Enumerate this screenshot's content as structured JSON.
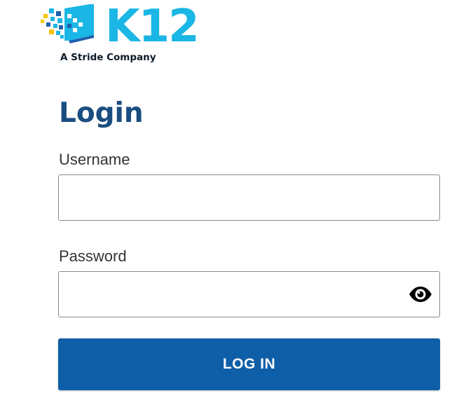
{
  "logo": {
    "wordmark": "K12",
    "tagline": "A Stride Company",
    "colors": {
      "cyan": "#1ab6e6",
      "blue": "#1e5fae",
      "yellow": "#f7c500",
      "navy": "#0d1b2a"
    }
  },
  "page": {
    "title": "Login"
  },
  "form": {
    "username_label": "Username",
    "username_value": "",
    "password_label": "Password",
    "password_value": "",
    "password_toggle_icon": "eye-icon",
    "submit_label": "LOG IN"
  },
  "colors": {
    "title": "#1a4d80",
    "button_bg": "#0f5ea8",
    "button_text": "#ffffff",
    "border": "#8a8a8a",
    "label": "#333333"
  }
}
